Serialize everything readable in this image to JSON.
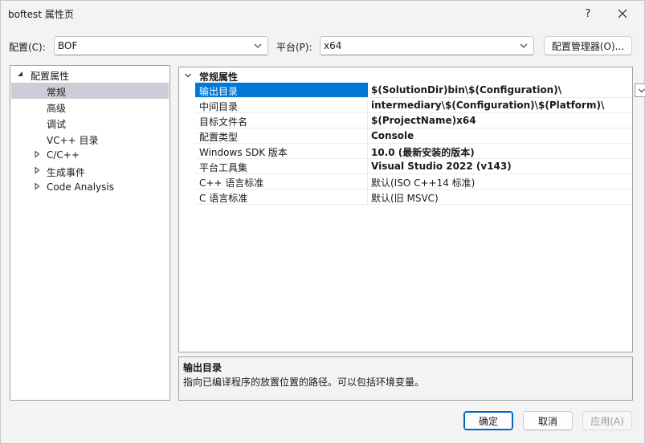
{
  "window": {
    "title": "boftest 属性页",
    "help_label": "?"
  },
  "toolbar": {
    "config_label": "配置(C):",
    "config_value": "BOF",
    "platform_label": "平台(P):",
    "platform_value": "x64",
    "config_manager_label": "配置管理器(O)..."
  },
  "tree": {
    "items": [
      {
        "label": "配置属性",
        "expander": "expanded"
      },
      {
        "label": "常规",
        "selected": true
      },
      {
        "label": "高级"
      },
      {
        "label": "调试"
      },
      {
        "label": "VC++ 目录"
      },
      {
        "label": "C/C++",
        "expander": "collapsed"
      },
      {
        "label": "生成事件",
        "expander": "collapsed"
      },
      {
        "label": "Code Analysis",
        "expander": "collapsed"
      }
    ]
  },
  "grid": {
    "category": "常规属性",
    "rows": [
      {
        "name": "输出目录",
        "value": "$(SolutionDir)bin\\$(Configuration)\\",
        "selected": true
      },
      {
        "name": "中间目录",
        "value": "intermediary\\$(Configuration)\\$(Platform)\\"
      },
      {
        "name": "目标文件名",
        "value": "$(ProjectName)x64"
      },
      {
        "name": "配置类型",
        "value": "Console"
      },
      {
        "name": "Windows SDK 版本",
        "value": "10.0 (最新安装的版本)"
      },
      {
        "name": "平台工具集",
        "value": "Visual Studio 2022 (v143)"
      },
      {
        "name": "C++ 语言标准",
        "value": "默认(ISO C++14 标准)"
      },
      {
        "name": "C 语言标准",
        "value": "默认(旧 MSVC)"
      }
    ]
  },
  "description": {
    "title": "输出目录",
    "text": "指向已编译程序的放置位置的路径。可以包括环境变量。"
  },
  "footer": {
    "ok_label": "确定",
    "cancel_label": "取消",
    "apply_label": "应用(A)"
  },
  "colors": {
    "selection": "#0078d7",
    "tree_selection": "#cdcdd7",
    "primary_border": "#0067c0"
  }
}
